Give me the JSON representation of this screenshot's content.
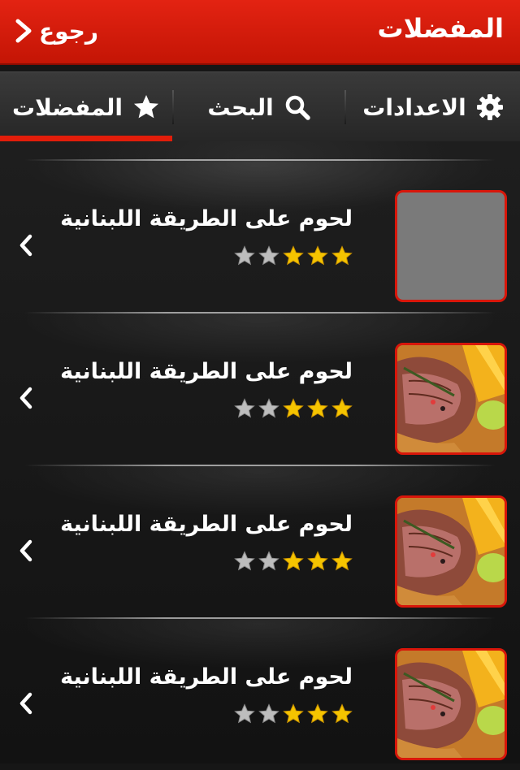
{
  "header": {
    "title": "المفضلات",
    "back_label": "رجوع"
  },
  "tabs": [
    {
      "label": "المفضلات",
      "icon": "star-icon",
      "active": true
    },
    {
      "label": "البحث",
      "icon": "search-icon",
      "active": false
    },
    {
      "label": "الاعدادات",
      "icon": "gear-icon",
      "active": false
    }
  ],
  "items": [
    {
      "title": "لحوم على الطريقة اللبنانية",
      "rating": 3,
      "max_rating": 5,
      "image": "placeholder"
    },
    {
      "title": "لحوم على الطريقة اللبنانية",
      "rating": 3,
      "max_rating": 5,
      "image": "steak-photo"
    },
    {
      "title": "لحوم على الطريقة اللبنانية",
      "rating": 3,
      "max_rating": 5,
      "image": "steak-photo"
    },
    {
      "title": "لحوم على الطريقة اللبنانية",
      "rating": 3,
      "max_rating": 5,
      "image": "steak-photo"
    }
  ],
  "colors": {
    "accent": "#e21d0a",
    "star_on": "#f5c400",
    "star_off": "#bdbdbd"
  }
}
